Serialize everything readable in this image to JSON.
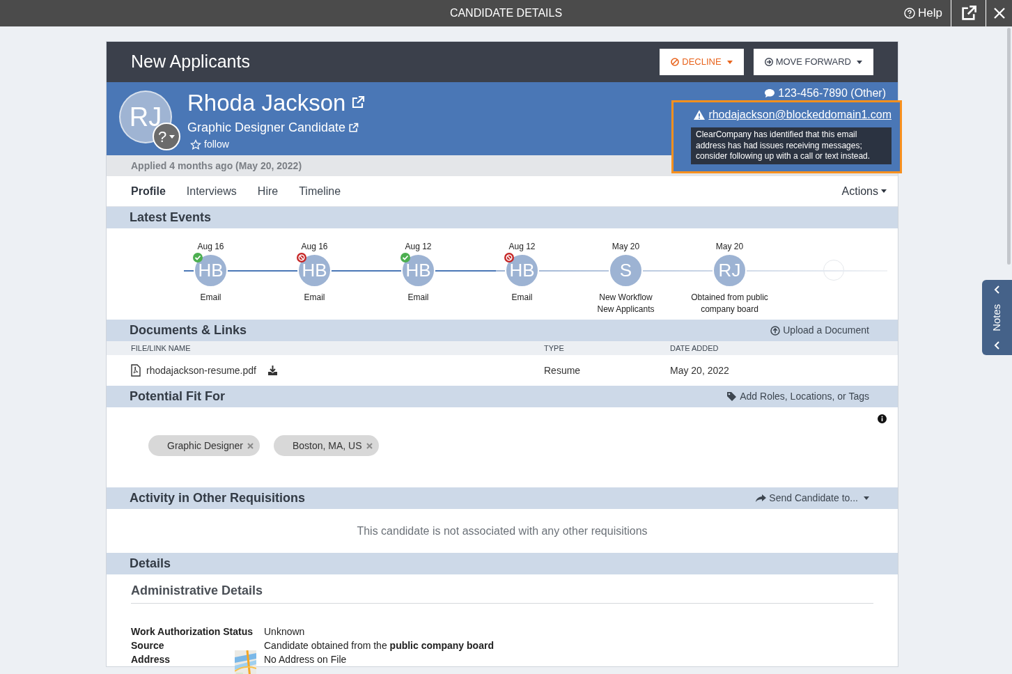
{
  "top_bar": {
    "title": "CANDIDATE DETAILS",
    "help": "Help"
  },
  "stage": {
    "title": "New Applicants",
    "buttons": [
      {
        "label": "DECLINE",
        "kind": "decline"
      },
      {
        "label": "MOVE FORWARD",
        "kind": "forward"
      }
    ]
  },
  "candidate": {
    "initials": "RJ",
    "badge": "?",
    "name": "Rhoda Jackson",
    "title": "Graphic Designer Candidate",
    "follow": "follow",
    "phone": "123-456-7890 (Other)",
    "email": "rhodajackson@blockeddomain1.com",
    "email_warning": "ClearCompany has identified that this email address has had issues receiving messages; consider following up with a call or text instead.",
    "applied": "Applied 4 months ago (May 20, 2022)"
  },
  "tabs": [
    {
      "label": "Profile",
      "selected": true
    },
    {
      "label": "Interviews",
      "selected": false
    },
    {
      "label": "Hire",
      "selected": false
    },
    {
      "label": "Timeline",
      "selected": false
    }
  ],
  "actions": "Actions",
  "latest_events": {
    "title": "Latest Events",
    "events": [
      {
        "date": "Aug 16",
        "initials": "HB",
        "kind": "success",
        "lines": [
          "Email"
        ]
      },
      {
        "date": "Aug 16",
        "initials": "HB",
        "kind": "blocked",
        "lines": [
          "Email"
        ]
      },
      {
        "date": "Aug 12",
        "initials": "HB",
        "kind": "success",
        "lines": [
          "Email"
        ]
      },
      {
        "date": "Aug 12",
        "initials": "HB",
        "kind": "blocked",
        "lines": [
          "Email"
        ]
      },
      {
        "date": "May 20",
        "initials": "S",
        "kind": "plain",
        "lines": [
          "New Workflow",
          "New Applicants"
        ]
      },
      {
        "date": "May 20",
        "initials": "RJ",
        "kind": "plain",
        "lines": [
          "Obtained from public",
          "company board"
        ]
      }
    ]
  },
  "documents": {
    "title": "Documents & Links",
    "action": "Upload a Document",
    "columns": [
      "FILE/LINK NAME",
      "TYPE",
      "DATE ADDED"
    ],
    "rows": [
      {
        "name": "rhodajackson-resume.pdf",
        "type": "Resume",
        "date": "May 20, 2022"
      }
    ]
  },
  "potential_fit": {
    "title": "Potential Fit For",
    "action": "Add Roles, Locations, or Tags",
    "tags": [
      "Graphic Designer",
      "Boston, MA, US"
    ]
  },
  "activity": {
    "title": "Activity in Other Requisitions",
    "action": "Send Candidate to...",
    "empty": "This candidate is not associated with any other requisitions"
  },
  "details": {
    "title": "Details",
    "subtitle": "Administrative Details",
    "fields": [
      {
        "label": "Work Authorization Status",
        "value": "Unknown",
        "kind": "text"
      },
      {
        "label": "Source",
        "value": "Candidate obtained from the **public company board**",
        "kind": "text"
      },
      {
        "label": "Address",
        "value": "No Address on File",
        "kind": "map"
      }
    ]
  },
  "notes_tab": "Notes"
}
